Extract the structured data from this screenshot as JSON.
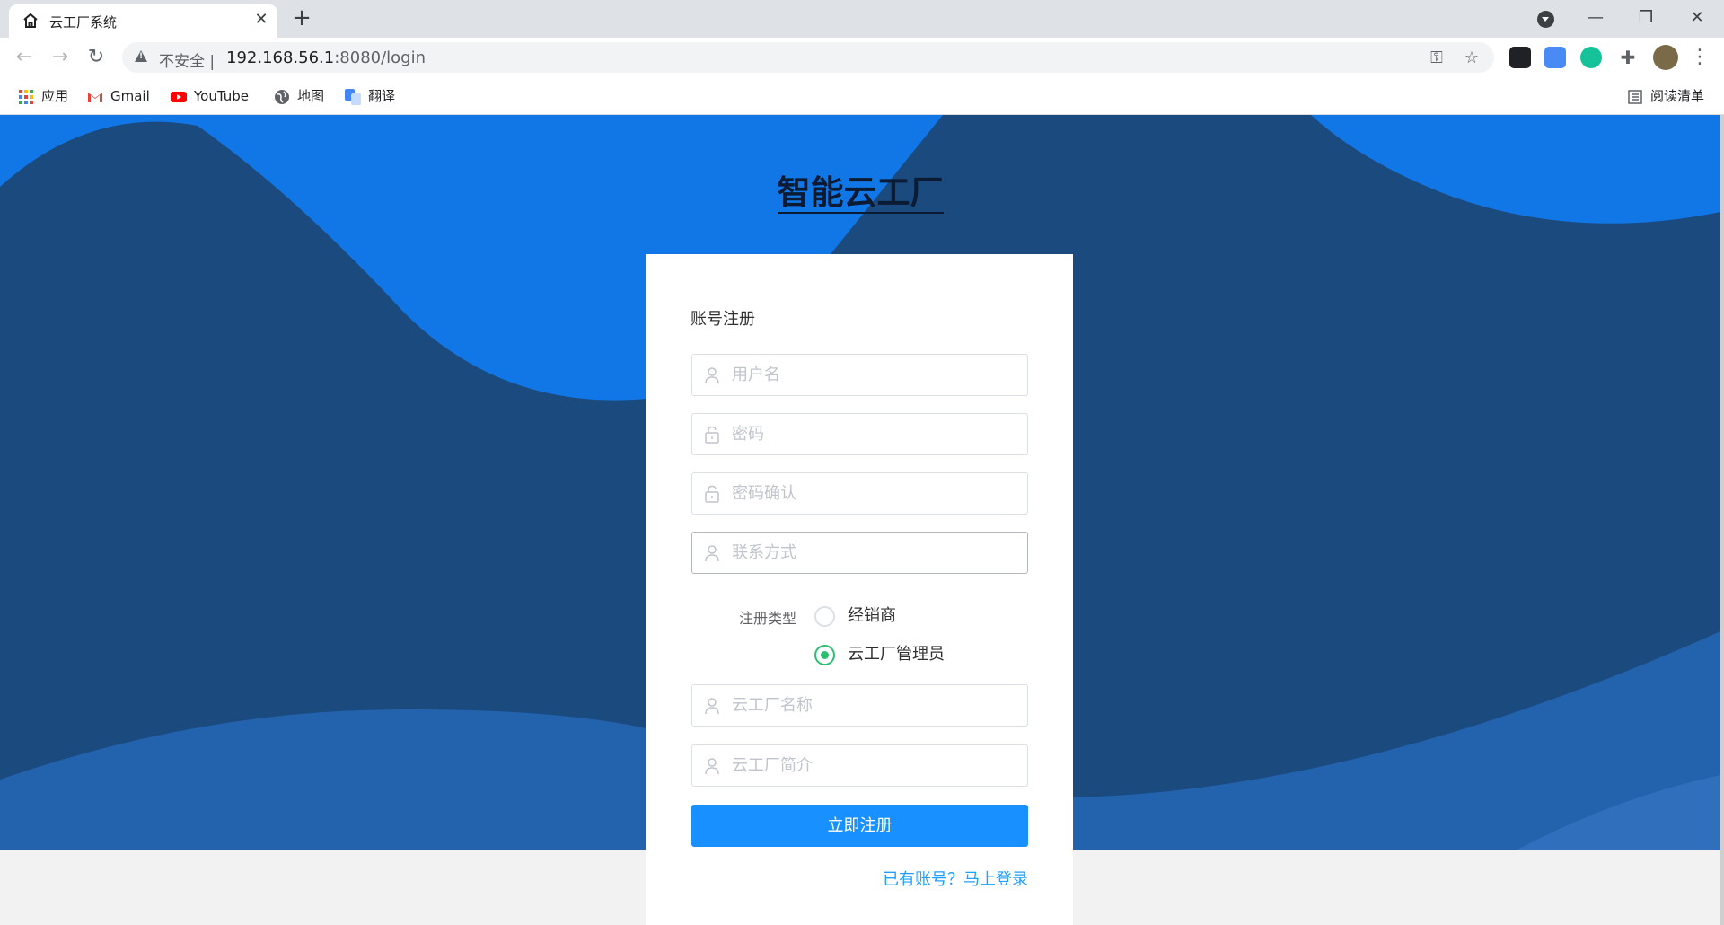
{
  "browser": {
    "tab_title": "云工厂系统",
    "tab_close": "✕",
    "new_tab": "+",
    "insecure_label": "不安全",
    "separator": "|",
    "url_host": "192.168.56.1",
    "url_path": ":8080/login",
    "bookmarks": [
      {
        "label": "应用",
        "icon": "apps-grid-icon"
      },
      {
        "label": "Gmail",
        "icon": "gmail-icon"
      },
      {
        "label": "YouTube",
        "icon": "youtube-icon"
      },
      {
        "label": "地图",
        "icon": "globe-icon"
      },
      {
        "label": "翻译",
        "icon": "translate-icon"
      }
    ],
    "reading_list": "阅读清单"
  },
  "page": {
    "site_title": "智能云工厂",
    "form": {
      "title": "账号注册",
      "username_placeholder": "用户名",
      "password_placeholder": "密码",
      "password_confirm_placeholder": "密码确认",
      "contact_placeholder": "联系方式",
      "register_type_label": "注册类型",
      "register_types": [
        {
          "label": "经销商",
          "checked": false
        },
        {
          "label": "云工厂管理员",
          "checked": true
        }
      ],
      "factory_name_placeholder": "云工厂名称",
      "factory_intro_placeholder": "云工厂简介",
      "submit_label": "立即注册",
      "login_link": "已有账号？马上登录"
    }
  },
  "colors": {
    "primary": "#1890ff",
    "wave_dark": "#1a4a7e",
    "wave_bright": "#1177e6",
    "radio_checked": "#2bbf73"
  }
}
